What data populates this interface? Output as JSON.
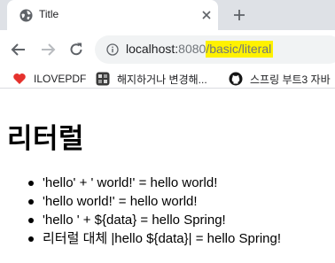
{
  "browser": {
    "tab": {
      "title": "Title"
    },
    "address": {
      "host": "localhost:",
      "port": "8080",
      "path": "/basic/literal",
      "highlight_color": "#fff200"
    },
    "bookmarks": [
      {
        "label": "ILOVEPDF",
        "icon": "heart-icon"
      },
      {
        "label": "해지하거나 변경해...",
        "icon": "app-icon"
      },
      {
        "label": "스프링 부트3 자바",
        "icon": "github-icon"
      }
    ]
  },
  "page": {
    "title": "리터럴",
    "items": [
      "'hello' + ' world!' = hello world!",
      "'hello world!' = hello world!",
      "'hello ' + ${data} = hello Spring!",
      "리터럴 대체 |hello ${data}| = hello Spring!"
    ]
  }
}
